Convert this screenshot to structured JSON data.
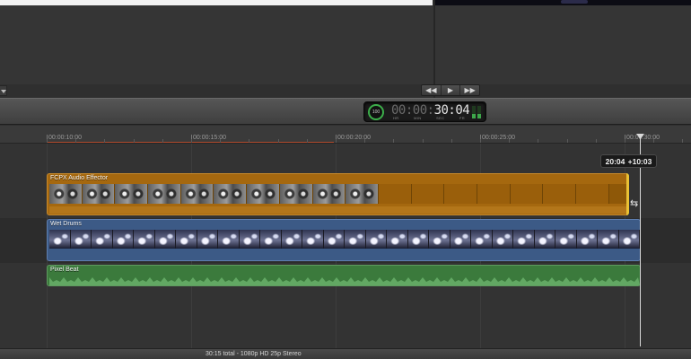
{
  "viewer": {
    "transport": {
      "previous_icon": "skip-back-icon",
      "play_icon": "play-icon",
      "next_icon": "skip-forward-icon"
    }
  },
  "dashboard": {
    "progress_label": "100",
    "timecode_dim": "00:00:",
    "timecode_lit": "30:04",
    "units": [
      "HR",
      "MIN",
      "SEC",
      "FR"
    ]
  },
  "ruler": {
    "ticks": [
      "00:00:10:00",
      "00:00:15:00",
      "00:00:20:00",
      "00:00:25:00",
      "00:00:30:00"
    ]
  },
  "clips": {
    "fcpx": {
      "title": "FCPX Audio Effector",
      "color": "#a5680f"
    },
    "drums": {
      "title": "Wet Drums",
      "color": "#3c5a86"
    },
    "beat": {
      "title": "Pixel Beat",
      "color": "#3b7a3c"
    }
  },
  "trim_tooltip": {
    "timecode": "20:04",
    "delta": "+10:03"
  },
  "status": {
    "text": "30:15 total - 1080p HD 25p Stereo"
  },
  "colors": {
    "playhead": "#d9d9d9",
    "trim_edge": "#e9c135",
    "meter_green": "#3da84a"
  }
}
